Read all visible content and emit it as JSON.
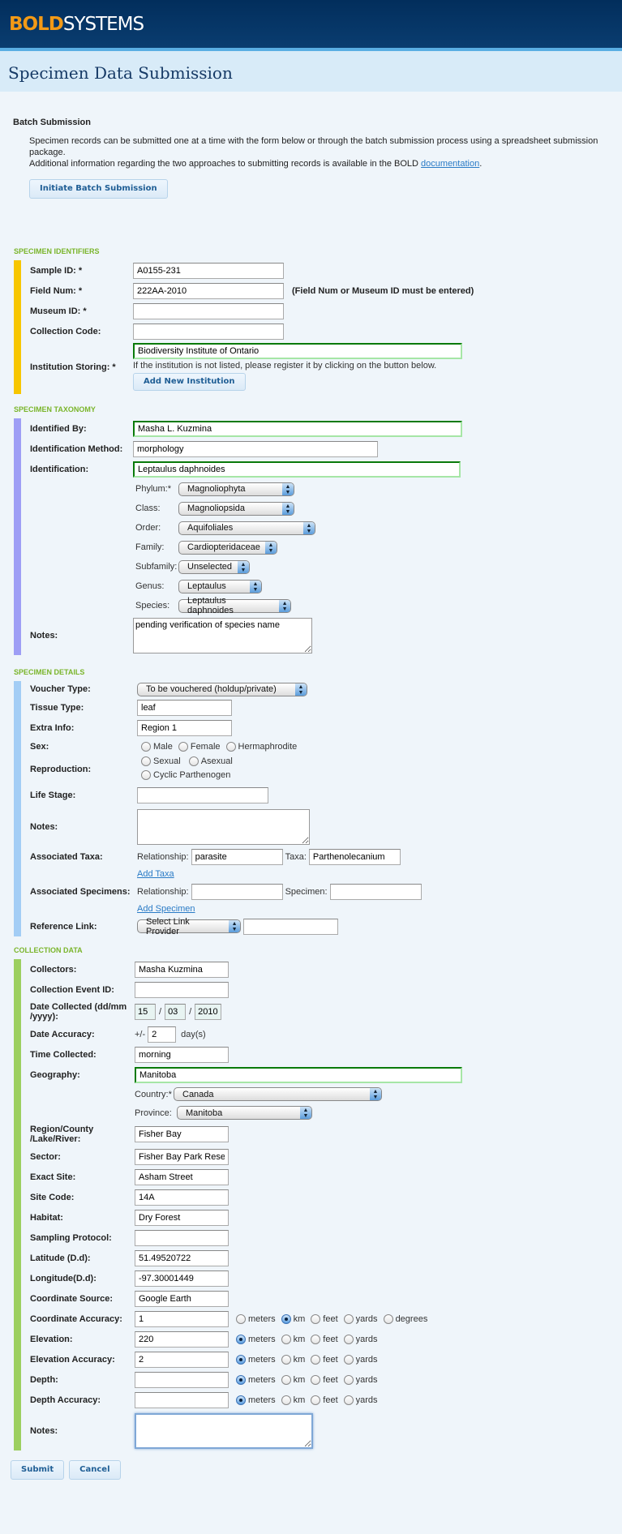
{
  "header": {
    "logo_bold": "BOLD",
    "logo_rest": "SYSTEMS",
    "page_title": "Specimen Data Submission"
  },
  "batch": {
    "title": "Batch Submission",
    "line1": "Specimen records can be submitted one at a time with the form below or through the batch submission process using a spreadsheet submission package.",
    "line2_pre": "Additional information regarding the two approaches to submitting records is available in the BOLD ",
    "link": "documentation",
    "line2_post": ".",
    "button": "Initiate Batch Submission"
  },
  "identifiers": {
    "title": "Specimen Identifiers",
    "color": "#f7c600",
    "sample_id": {
      "label": "Sample ID: *",
      "value": "A0155-231"
    },
    "field_num": {
      "label": "Field Num: *",
      "value": "222AA-2010",
      "note": "(Field Num or Museum ID must be entered)"
    },
    "museum_id": {
      "label": "Museum ID: *",
      "value": ""
    },
    "collection_code": {
      "label": "Collection Code:",
      "value": ""
    },
    "institution": {
      "label": "Institution Storing: *",
      "value": "Biodiversity Institute of Ontario",
      "hint": "If the institution is not listed, please register it by clicking on the button below.",
      "button": "Add New Institution"
    }
  },
  "taxonomy": {
    "title": "Specimen Taxonomy",
    "color": "#9e9ef5",
    "identified_by": {
      "label": "Identified By:",
      "value": "Masha L. Kuzmina"
    },
    "method": {
      "label": "Identification Method:",
      "value": "morphology"
    },
    "identification": {
      "label": "Identification:",
      "value": "Leptaulus daphnoides"
    },
    "ranks": [
      {
        "label": "Phylum:*",
        "value": "Magnoliophyta"
      },
      {
        "label": "Class:",
        "value": "Magnoliopsida"
      },
      {
        "label": "Order:",
        "value": "Aquifoliales"
      },
      {
        "label": "Family:",
        "value": "Cardiopteridaceae"
      },
      {
        "label": "Subfamily:",
        "value": "Unselected"
      },
      {
        "label": "Genus:",
        "value": "Leptaulus"
      },
      {
        "label": "Species:",
        "value": "Leptaulus daphnoides"
      }
    ],
    "notes": {
      "label": "Notes:",
      "value": "pending verification of species name"
    }
  },
  "details": {
    "title": "Specimen Details",
    "color": "#a3cdf5",
    "voucher": {
      "label": "Voucher Type:",
      "value": "To be vouchered (holdup/private)"
    },
    "tissue": {
      "label": "Tissue Type:",
      "value": "leaf"
    },
    "extra": {
      "label": "Extra Info:",
      "value": "Region 1"
    },
    "sex": {
      "label": "Sex:",
      "options": [
        "Male",
        "Female",
        "Hermaphrodite"
      ]
    },
    "reproduction": {
      "label": "Reproduction:",
      "options": [
        "Sexual",
        "Asexual",
        "Cyclic Parthenogen"
      ]
    },
    "life_stage": {
      "label": "Life Stage:",
      "value": ""
    },
    "notes": {
      "label": "Notes:",
      "value": ""
    },
    "assoc_taxa": {
      "label": "Associated Taxa:",
      "rel_label": "Relationship:",
      "rel_value": "parasite",
      "taxa_label": "Taxa:",
      "taxa_value": "Parthenolecanium",
      "add": "Add Taxa"
    },
    "assoc_spec": {
      "label": "Associated Specimens:",
      "rel_label": "Relationship:",
      "rel_value": "",
      "spec_label": "Specimen:",
      "spec_value": "",
      "add": "Add Specimen"
    },
    "ref_link": {
      "label": "Reference Link:",
      "select": "Select Link Provider",
      "value": ""
    }
  },
  "collection": {
    "title": "Collection Data",
    "color": "#9ccf5f",
    "collectors": {
      "label": "Collectors:",
      "value": "Masha Kuzmina"
    },
    "event_id": {
      "label": "Collection Event ID:",
      "value": ""
    },
    "date": {
      "label": "Date Collected (dd/mm /yyyy):",
      "dd": "15",
      "mm": "03",
      "yyyy": "2010",
      "sep": "/"
    },
    "date_acc": {
      "label": "Date Accuracy:",
      "prefix": "+/-",
      "value": "2",
      "suffix": "day(s)"
    },
    "time": {
      "label": "Time Collected:",
      "value": "morning"
    },
    "geography": {
      "label": "Geography:",
      "value": "Manitoba"
    },
    "country": {
      "label": "Country:*",
      "value": "Canada"
    },
    "province": {
      "label": "Province:",
      "value": "Manitoba"
    },
    "region": {
      "label": "Region/County /Lake/River:",
      "value": "Fisher Bay"
    },
    "sector": {
      "label": "Sector:",
      "value": "Fisher Bay Park Reserv"
    },
    "exact_site": {
      "label": "Exact Site:",
      "value": "Asham Street"
    },
    "site_code": {
      "label": "Site Code:",
      "value": "14A"
    },
    "habitat": {
      "label": "Habitat:",
      "value": "Dry Forest"
    },
    "sampling": {
      "label": "Sampling Protocol:",
      "value": ""
    },
    "latitude": {
      "label": "Latitude (D.d):",
      "value": "51.49520722"
    },
    "longitude": {
      "label": "Longitude(D.d):",
      "value": "-97.30001449"
    },
    "coord_source": {
      "label": "Coordinate Source:",
      "value": "Google Earth"
    },
    "coord_acc": {
      "label": "Coordinate Accuracy:",
      "value": "1",
      "units": [
        "meters",
        "km",
        "feet",
        "yards",
        "degrees"
      ],
      "selected": "km"
    },
    "elevation": {
      "label": "Elevation:",
      "value": "220",
      "units": [
        "meters",
        "km",
        "feet",
        "yards"
      ],
      "selected": "meters"
    },
    "elev_acc": {
      "label": "Elevation Accuracy:",
      "value": "2",
      "units": [
        "meters",
        "km",
        "feet",
        "yards"
      ],
      "selected": "meters"
    },
    "depth": {
      "label": "Depth:",
      "value": "",
      "units": [
        "meters",
        "km",
        "feet",
        "yards"
      ],
      "selected": "meters"
    },
    "depth_acc": {
      "label": "Depth Accuracy:",
      "value": "",
      "units": [
        "meters",
        "km",
        "feet",
        "yards"
      ],
      "selected": "meters"
    },
    "notes": {
      "label": "Notes:",
      "value": ""
    }
  },
  "actions": {
    "submit": "Submit",
    "cancel": "Cancel"
  }
}
